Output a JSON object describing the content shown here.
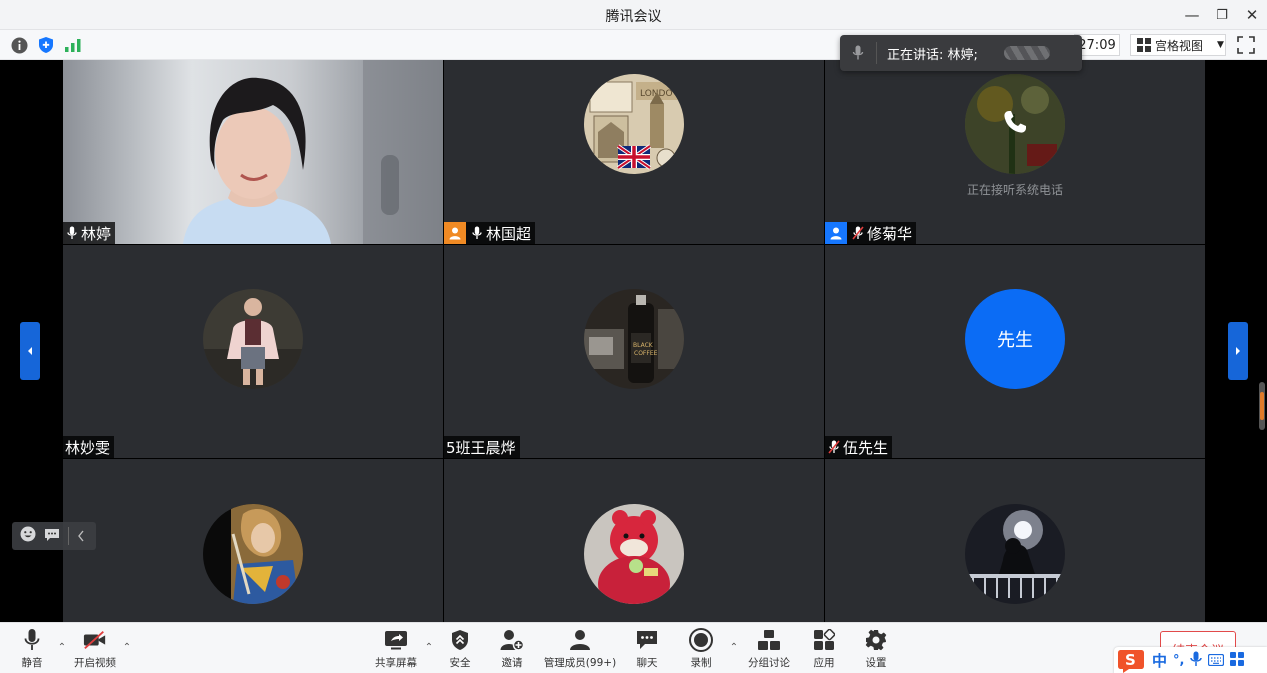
{
  "window": {
    "title": "腾讯会议",
    "minimize_glyph": "—",
    "restore_glyph": "❐",
    "close_glyph": "✕"
  },
  "infobar": {
    "duration": "27:09",
    "view_mode": "宫格视图",
    "icons": [
      "info-icon",
      "security-shield-icon",
      "signal-strength-icon"
    ]
  },
  "speaker": {
    "text": "正在讲话: 林婷;"
  },
  "tiles": [
    {
      "name": "林婷",
      "type": "video",
      "mic": "on",
      "active": true
    },
    {
      "name": "林国超",
      "type": "avatar",
      "mic": "on",
      "badge": "host"
    },
    {
      "name": "修菊华",
      "type": "phone",
      "mic": "muted",
      "badge": "cohost",
      "caption": "正在接听系统电话"
    },
    {
      "name": "林妙雯",
      "type": "avatar",
      "mic": "none"
    },
    {
      "name": "5班王晨烨",
      "type": "avatar",
      "mic": "none"
    },
    {
      "name": "伍先生",
      "type": "initials",
      "mic": "muted",
      "initials": "先生"
    },
    {
      "name": "",
      "type": "avatar"
    },
    {
      "name": "",
      "type": "avatar"
    },
    {
      "name": "",
      "type": "avatar"
    }
  ],
  "toolbar": {
    "mute": "静音",
    "video": "开启视频",
    "share": "共享屏幕",
    "security": "安全",
    "invite": "邀请",
    "members": "管理成员(99+)",
    "chat": "聊天",
    "record": "录制",
    "breakout": "分组讨论",
    "apps": "应用",
    "settings": "设置",
    "end": "结束会议"
  },
  "ime": {
    "lang": "中",
    "punct": "°,"
  },
  "colors": {
    "accent": "#1666d9",
    "host_badge": "#f08a24",
    "cohost_badge": "#1677ff",
    "initials_avatar": "#0b6cf5",
    "end_button": "#e24a4a",
    "active_speaker": "#2fb26b"
  }
}
